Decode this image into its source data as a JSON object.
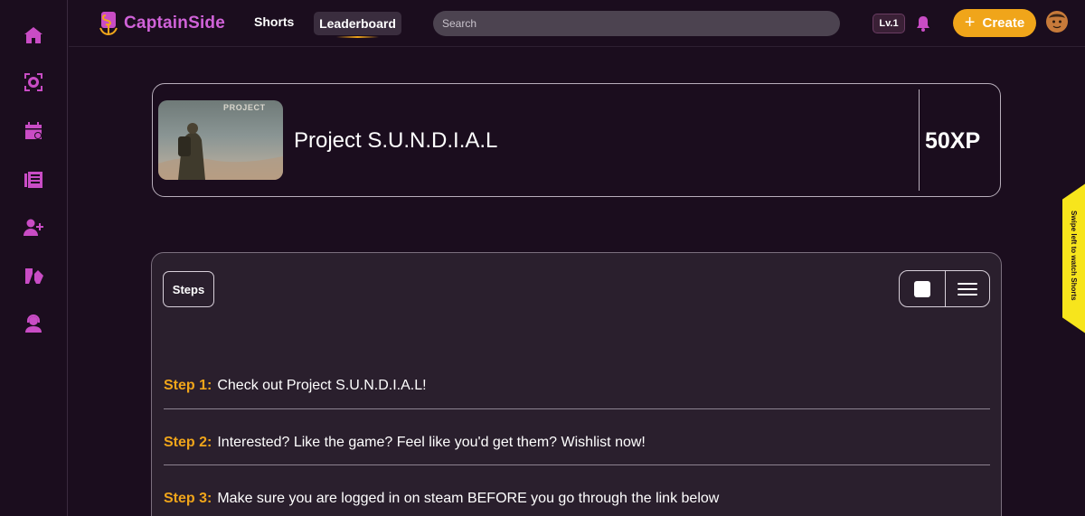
{
  "app": {
    "brand": "CaptainSide",
    "accent_color": "#c94cc5",
    "highlight_color": "#f0a51a"
  },
  "sidebar": {
    "items": [
      {
        "icon": "home-icon"
      },
      {
        "icon": "radar-icon"
      },
      {
        "icon": "calendar-icon"
      },
      {
        "icon": "news-icon"
      },
      {
        "icon": "add-friend-icon"
      },
      {
        "icon": "gamepad-icon"
      },
      {
        "icon": "support-agent-icon"
      }
    ]
  },
  "header": {
    "nav_shorts": "Shorts",
    "nav_leaderboard": "Leaderboard",
    "search_placeholder": "Search",
    "level": "Lv.1",
    "create_plus": "+",
    "create_label": "Create"
  },
  "project": {
    "thumbnail_text": "PROJECT",
    "title": "Project S.U.N.D.I.A.L",
    "xp": "50XP"
  },
  "steps": {
    "tab_label": "Steps",
    "items": [
      {
        "label": "Step 1:",
        "text": "Check out Project S.U.N.D.I.A.L!"
      },
      {
        "label": "Step 2:",
        "text": "Interested? Like the game? Feel like you'd get them? Wishlist now!"
      },
      {
        "label": "Step 3:",
        "text": "Make sure you are logged in on steam BEFORE you go through the link below"
      }
    ]
  },
  "swipe_hint": "Swipe left to watch Shorts"
}
